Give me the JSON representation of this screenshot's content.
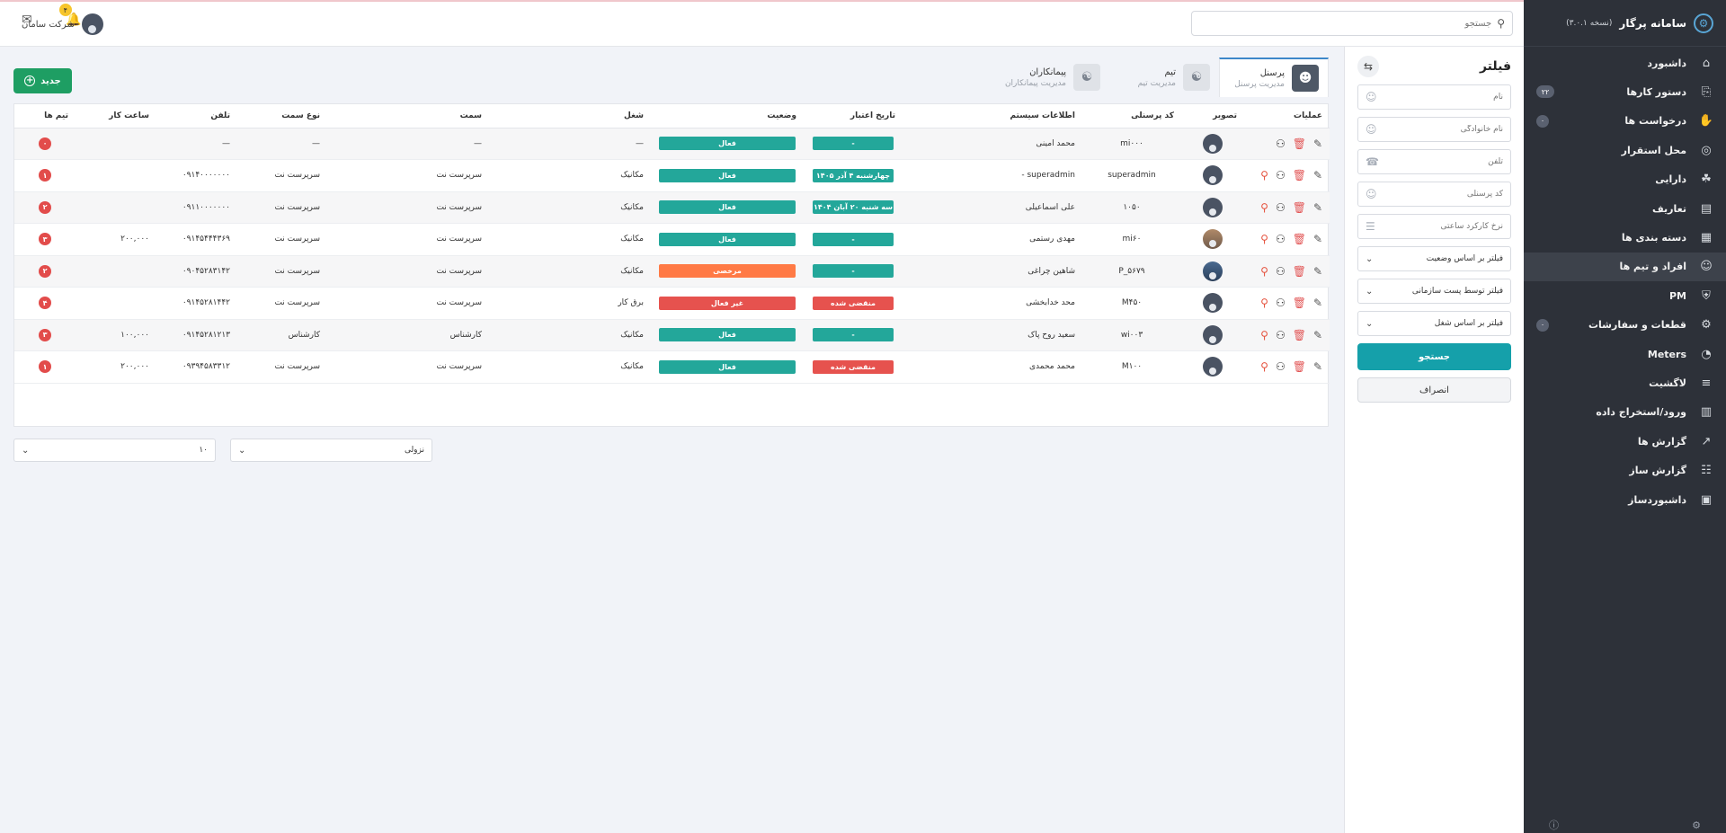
{
  "sidebar": {
    "title": "سامانه پرگار",
    "version": "(نسخه ۳.۰.۱)",
    "items": [
      {
        "label": "داشبورد",
        "icon": "home-icon",
        "badge": null
      },
      {
        "label": "دستور کارها",
        "icon": "clipboard-icon",
        "badge": "۲۲"
      },
      {
        "label": "درخواست ها",
        "icon": "hand-icon",
        "badge": "۰"
      },
      {
        "label": "محل استقرار",
        "icon": "location-pin-icon",
        "badge": null
      },
      {
        "label": "دارایی",
        "icon": "asset-tree-icon",
        "badge": null
      },
      {
        "label": "تعاریف",
        "icon": "book-icon",
        "badge": null
      },
      {
        "label": "دسته بندی ها",
        "icon": "grid-icon",
        "badge": null
      },
      {
        "label": "افراد و تیم ها",
        "icon": "people-icon",
        "badge": null
      },
      {
        "label": "PM",
        "icon": "shield-icon",
        "badge": null
      },
      {
        "label": "قطعات و سفارشات",
        "icon": "gear-icon",
        "badge": "۰"
      },
      {
        "label": "Meters",
        "icon": "gauge-icon",
        "badge": null
      },
      {
        "label": "لاگشیت",
        "icon": "log-icon",
        "badge": null
      },
      {
        "label": "ورود/استخراج داده",
        "icon": "database-table-icon",
        "badge": null
      },
      {
        "label": "گزارش ها",
        "icon": "line-chart-icon",
        "badge": null
      },
      {
        "label": "گزارش ساز",
        "icon": "stack-icon",
        "badge": null
      },
      {
        "label": "داشبوردساز",
        "icon": "layout-icon",
        "badge": null
      }
    ]
  },
  "topbar": {
    "search_placeholder": "جستجو",
    "company": "شرکت سامان",
    "notif_count": "۴"
  },
  "filter": {
    "title": "فیلتر",
    "fields": [
      {
        "placeholder": "نام"
      },
      {
        "placeholder": "نام خانوادگی"
      },
      {
        "placeholder": "تلفن"
      },
      {
        "placeholder": "کد پرسنلی"
      },
      {
        "placeholder": "نرخ کارکرد ساعتی"
      }
    ],
    "selects": [
      "فیلتر بر اساس وضعیت",
      "فیلتر توسط پست سازمانی",
      "فیلتر بر اساس شغل"
    ],
    "search_label": "جستجو",
    "cancel_label": "انصراف"
  },
  "main": {
    "new_label": "جدید",
    "tabs": [
      {
        "title": "پرسنل",
        "subtitle": "مدیریت پرسنل"
      },
      {
        "title": "تیم",
        "subtitle": "مدیریت تیم"
      },
      {
        "title": "پیمانکاران",
        "subtitle": "مدیریت پیمانکاران"
      }
    ],
    "columns": [
      "عملیات",
      "تصویر",
      "کد پرسنلی",
      "اطلاعات سیستم",
      "تاریخ اعتبار",
      "وضعیت",
      "شغل",
      "سمت",
      "نوع سمت",
      "تلفن",
      "ساعت کار",
      "تیم ها"
    ],
    "rows": [
      {
        "code": "mi۰۰۰",
        "name": "محمد امینی",
        "date": "-",
        "date_color": "teal",
        "status": "فعال",
        "status_color": "teal",
        "job": "—",
        "position": "—",
        "ptype": "—",
        "phone": "—",
        "hours": "",
        "teams": "۰",
        "key": false,
        "photo": ""
      },
      {
        "code": "superadmin",
        "name": "superadmin -",
        "date": "چهارشنبه ۴ آذر ۱۴۰۵",
        "date_color": "teal",
        "status": "فعال",
        "status_color": "teal",
        "job": "مکانیک",
        "position": "سرپرست نت",
        "ptype": "سرپرست نت",
        "phone": "۰۹۱۴۰۰۰۰۰۰۰",
        "hours": "",
        "teams": "۱",
        "key": true,
        "photo": ""
      },
      {
        "code": "۱۰۵۰",
        "name": "علی اسماعیلی",
        "date": "سه شنبه ۲۰ آبان ۱۴۰۴",
        "date_color": "teal",
        "status": "فعال",
        "status_color": "teal",
        "job": "مکانیک",
        "position": "سرپرست نت",
        "ptype": "سرپرست نت",
        "phone": "۰۹۱۱۰۰۰۰۰۰۰",
        "hours": "",
        "teams": "۲",
        "key": true,
        "photo": ""
      },
      {
        "code": "mi۶۰",
        "name": "مهدی رستمی",
        "date": "-",
        "date_color": "teal",
        "status": "فعال",
        "status_color": "teal",
        "job": "مکانیک",
        "position": "سرپرست نت",
        "ptype": "سرپرست نت",
        "phone": "۰۹۱۴۵۴۴۴۳۶۹",
        "hours": "۲۰۰,۰۰۰",
        "teams": "۳",
        "key": true,
        "photo": "pic1"
      },
      {
        "code": "P_۵۶۷۹",
        "name": "شاهین چراغی",
        "date": "-",
        "date_color": "teal",
        "status": "مرخصی",
        "status_color": "orange",
        "job": "مکانیک",
        "position": "سرپرست نت",
        "ptype": "سرپرست نت",
        "phone": "۰۹۰۴۵۲۸۳۱۴۲",
        "hours": "",
        "teams": "۲",
        "key": true,
        "photo": "pic2"
      },
      {
        "code": "M۴۵۰",
        "name": "محد خدابخشی",
        "date": "منقضی شده",
        "date_color": "red",
        "status": "غیر فعال",
        "status_color": "red",
        "job": "برق کار",
        "position": "سرپرست نت",
        "ptype": "سرپرست نت",
        "phone": "۰۹۱۴۵۲۸۱۴۴۲",
        "hours": "",
        "teams": "۴",
        "key": true,
        "photo": ""
      },
      {
        "code": "wi۰۰۳",
        "name": "سعید روح پاک",
        "date": "-",
        "date_color": "teal",
        "status": "فعال",
        "status_color": "teal",
        "job": "مکانیک",
        "position": "کارشناس",
        "ptype": "کارشناس",
        "phone": "۰۹۱۴۵۲۸۱۲۱۳",
        "hours": "۱۰۰,۰۰۰",
        "teams": "۳",
        "key": true,
        "photo": ""
      },
      {
        "code": "M۱۰۰",
        "name": "محمد محمدی",
        "date": "منقضی شده",
        "date_color": "red",
        "status": "فعال",
        "status_color": "teal",
        "job": "مکانیک",
        "position": "سرپرست نت",
        "ptype": "سرپرست نت",
        "phone": "۰۹۳۹۴۵۸۳۳۱۲",
        "hours": "۲۰۰,۰۰۰",
        "teams": "۱",
        "key": true,
        "photo": ""
      }
    ],
    "sort_value": "نزولی",
    "page_size": "۱۰"
  }
}
